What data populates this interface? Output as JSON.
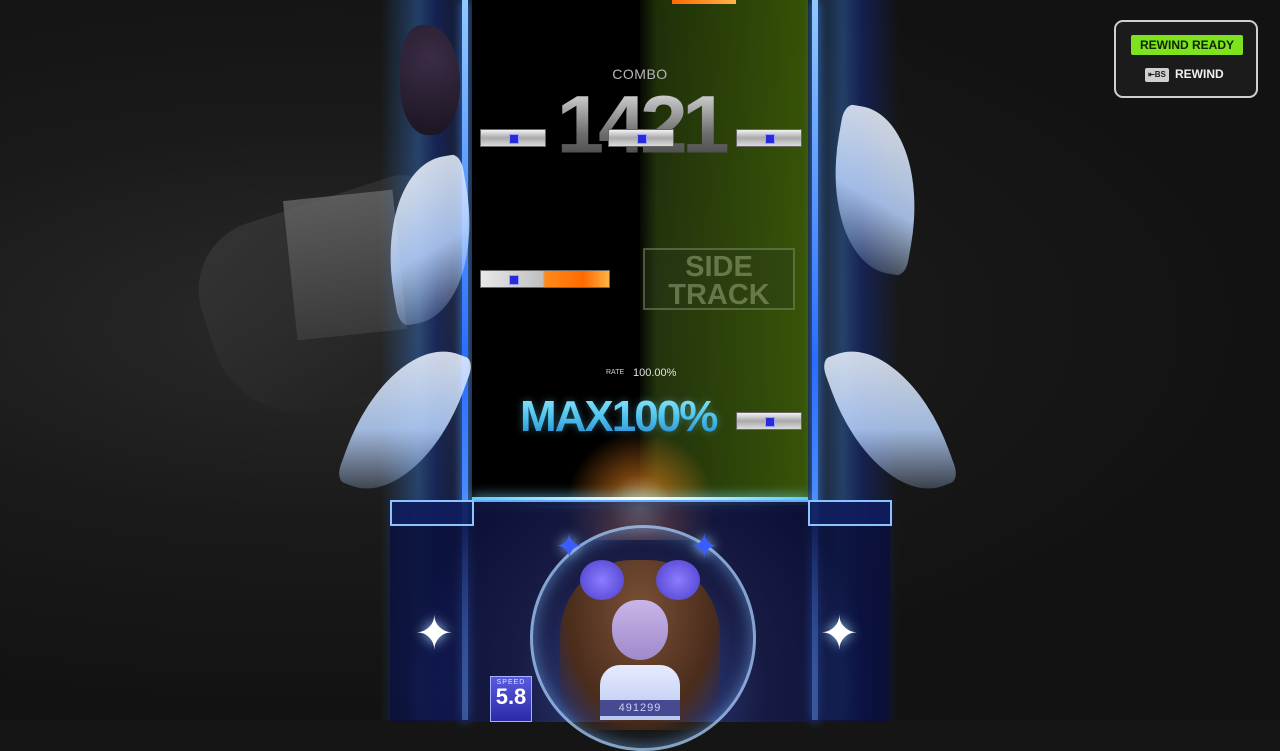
{
  "hud": {
    "combo_label": "COMBO",
    "combo_count": "1421",
    "rate_label": "RATE",
    "rate_value": "100.00%",
    "judgement": "MAX100%",
    "lane_banner": [
      "SIDE",
      "TRACK"
    ],
    "speed_label": "SPEED",
    "speed_value": "5.8",
    "score": "491299"
  },
  "rewind": {
    "status": "REWIND READY",
    "key_hint": "⇤BS",
    "action_label": "REWIND",
    "status_color": "#7ee21e"
  },
  "colors": {
    "note_marker": "#2a2bd8",
    "long_note": "#ff6a00",
    "judge_line": "#4fd0ff",
    "frame_accent": "#2a6cff"
  },
  "icons": [
    "sparkle-icon",
    "backspace-key-icon"
  ]
}
